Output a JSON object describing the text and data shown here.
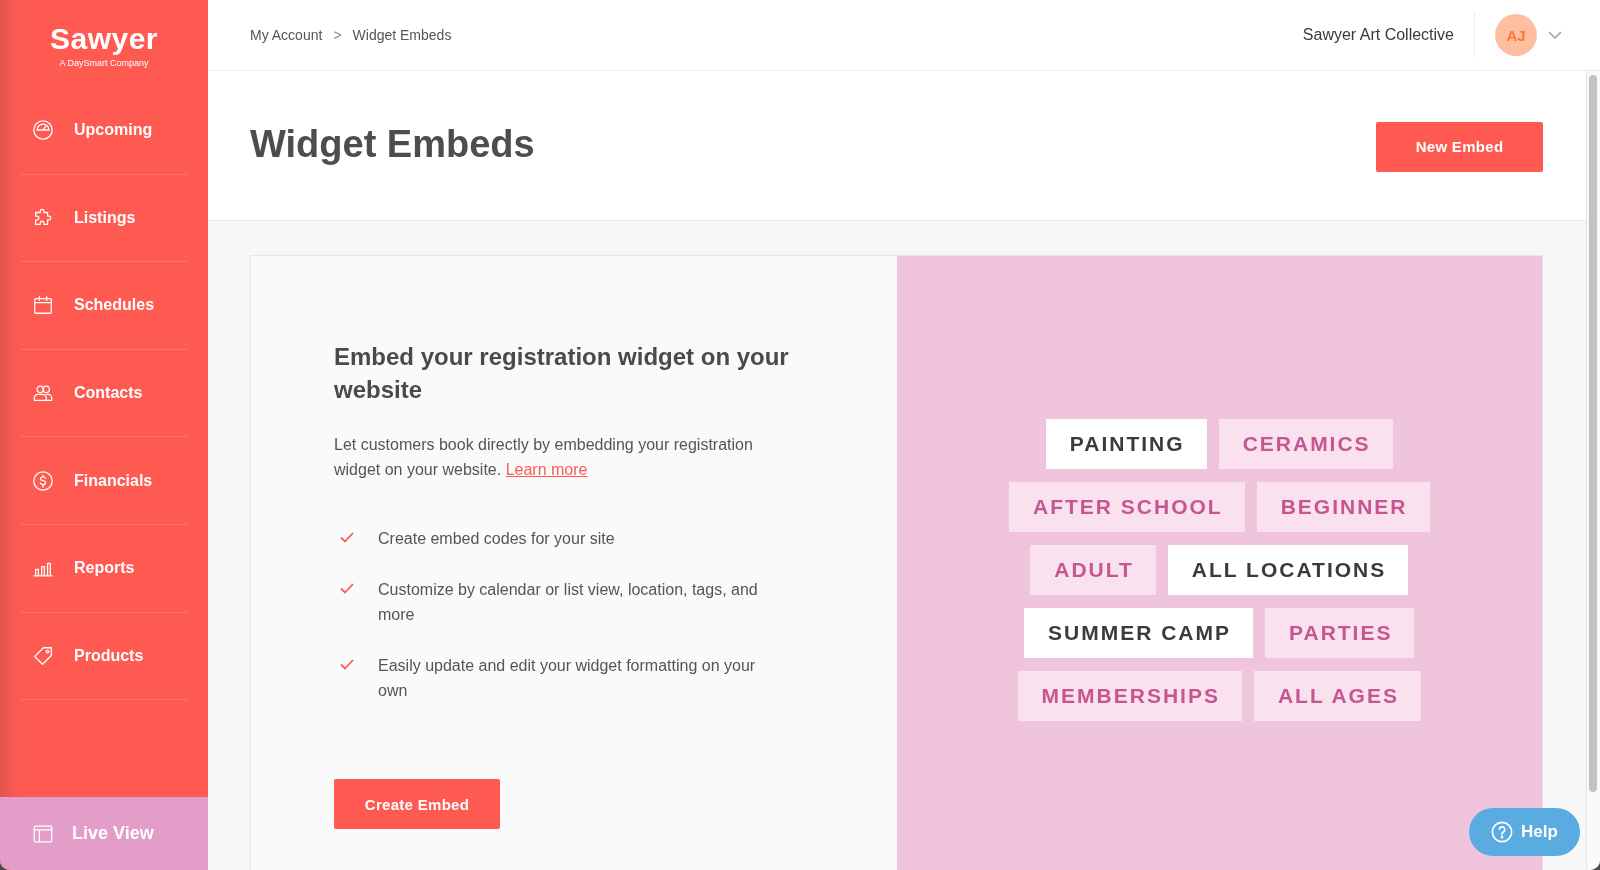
{
  "sidebar": {
    "logo": "Sawyer",
    "tagline": "A DaySmart Company",
    "items": [
      {
        "label": "Upcoming"
      },
      {
        "label": "Listings"
      },
      {
        "label": "Schedules"
      },
      {
        "label": "Contacts"
      },
      {
        "label": "Financials"
      },
      {
        "label": "Reports"
      },
      {
        "label": "Products"
      }
    ],
    "live_view": {
      "label": "Live View"
    }
  },
  "top_bar": {
    "breadcrumb": {
      "items": [
        "My Account",
        "Widget Embeds"
      ],
      "separator": ">"
    },
    "organization": "Sawyer Art Collective",
    "avatar_initials": "AJ"
  },
  "page_header": {
    "title": "Widget Embeds",
    "button": "New Embed"
  },
  "embed_card": {
    "heading": "Embed your registration widget on your website",
    "description": "Let customers book directly by embedding your registration widget on your website.",
    "link": "Learn more",
    "features": [
      "Create embed codes for your site",
      "Customize by calendar or list view, location, tags, and more",
      "Easily update and edit your widget formatting on your own"
    ],
    "button": "Create Embed",
    "tags": [
      {
        "label": "PAINTING",
        "selected": true
      },
      {
        "label": "CERAMICS",
        "selected": false
      },
      {
        "label": "AFTER SCHOOL",
        "selected": false
      },
      {
        "label": "BEGINNER",
        "selected": false
      },
      {
        "label": "ADULT",
        "selected": false
      },
      {
        "label": "ALL LOCATIONS",
        "selected": true
      },
      {
        "label": "SUMMER CAMP",
        "selected": true
      },
      {
        "label": "PARTIES",
        "selected": false
      },
      {
        "label": "MEMBERSHIPS",
        "selected": false
      },
      {
        "label": "ALL AGES",
        "selected": false
      }
    ]
  },
  "help_button": {
    "label": "Help"
  }
}
